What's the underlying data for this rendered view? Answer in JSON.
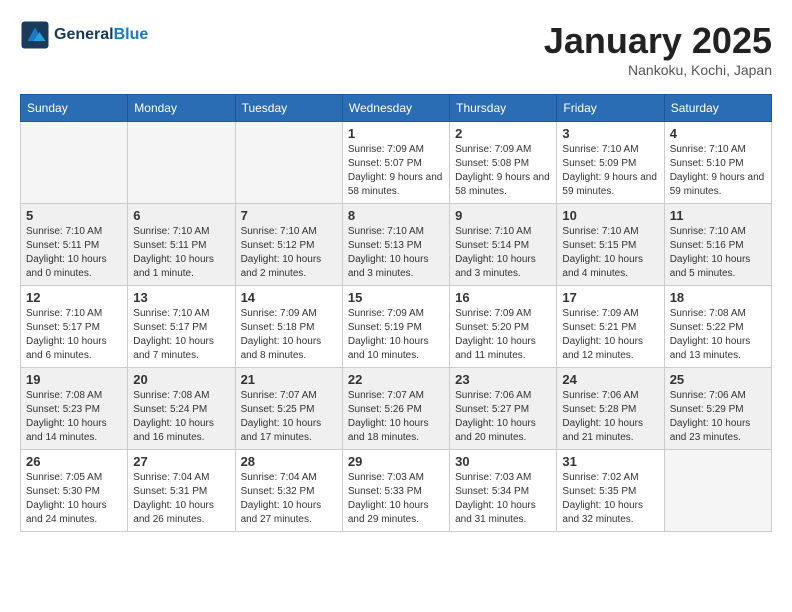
{
  "header": {
    "logo_line1": "General",
    "logo_line2": "Blue",
    "month_title": "January 2025",
    "location": "Nankoku, Kochi, Japan"
  },
  "days_of_week": [
    "Sunday",
    "Monday",
    "Tuesday",
    "Wednesday",
    "Thursday",
    "Friday",
    "Saturday"
  ],
  "weeks": [
    {
      "shaded": false,
      "days": [
        {
          "num": "",
          "sunrise": "",
          "sunset": "",
          "daylight": ""
        },
        {
          "num": "",
          "sunrise": "",
          "sunset": "",
          "daylight": ""
        },
        {
          "num": "",
          "sunrise": "",
          "sunset": "",
          "daylight": ""
        },
        {
          "num": "1",
          "sunrise": "Sunrise: 7:09 AM",
          "sunset": "Sunset: 5:07 PM",
          "daylight": "Daylight: 9 hours and 58 minutes."
        },
        {
          "num": "2",
          "sunrise": "Sunrise: 7:09 AM",
          "sunset": "Sunset: 5:08 PM",
          "daylight": "Daylight: 9 hours and 58 minutes."
        },
        {
          "num": "3",
          "sunrise": "Sunrise: 7:10 AM",
          "sunset": "Sunset: 5:09 PM",
          "daylight": "Daylight: 9 hours and 59 minutes."
        },
        {
          "num": "4",
          "sunrise": "Sunrise: 7:10 AM",
          "sunset": "Sunset: 5:10 PM",
          "daylight": "Daylight: 9 hours and 59 minutes."
        }
      ]
    },
    {
      "shaded": true,
      "days": [
        {
          "num": "5",
          "sunrise": "Sunrise: 7:10 AM",
          "sunset": "Sunset: 5:11 PM",
          "daylight": "Daylight: 10 hours and 0 minutes."
        },
        {
          "num": "6",
          "sunrise": "Sunrise: 7:10 AM",
          "sunset": "Sunset: 5:11 PM",
          "daylight": "Daylight: 10 hours and 1 minute."
        },
        {
          "num": "7",
          "sunrise": "Sunrise: 7:10 AM",
          "sunset": "Sunset: 5:12 PM",
          "daylight": "Daylight: 10 hours and 2 minutes."
        },
        {
          "num": "8",
          "sunrise": "Sunrise: 7:10 AM",
          "sunset": "Sunset: 5:13 PM",
          "daylight": "Daylight: 10 hours and 3 minutes."
        },
        {
          "num": "9",
          "sunrise": "Sunrise: 7:10 AM",
          "sunset": "Sunset: 5:14 PM",
          "daylight": "Daylight: 10 hours and 3 minutes."
        },
        {
          "num": "10",
          "sunrise": "Sunrise: 7:10 AM",
          "sunset": "Sunset: 5:15 PM",
          "daylight": "Daylight: 10 hours and 4 minutes."
        },
        {
          "num": "11",
          "sunrise": "Sunrise: 7:10 AM",
          "sunset": "Sunset: 5:16 PM",
          "daylight": "Daylight: 10 hours and 5 minutes."
        }
      ]
    },
    {
      "shaded": false,
      "days": [
        {
          "num": "12",
          "sunrise": "Sunrise: 7:10 AM",
          "sunset": "Sunset: 5:17 PM",
          "daylight": "Daylight: 10 hours and 6 minutes."
        },
        {
          "num": "13",
          "sunrise": "Sunrise: 7:10 AM",
          "sunset": "Sunset: 5:17 PM",
          "daylight": "Daylight: 10 hours and 7 minutes."
        },
        {
          "num": "14",
          "sunrise": "Sunrise: 7:09 AM",
          "sunset": "Sunset: 5:18 PM",
          "daylight": "Daylight: 10 hours and 8 minutes."
        },
        {
          "num": "15",
          "sunrise": "Sunrise: 7:09 AM",
          "sunset": "Sunset: 5:19 PM",
          "daylight": "Daylight: 10 hours and 10 minutes."
        },
        {
          "num": "16",
          "sunrise": "Sunrise: 7:09 AM",
          "sunset": "Sunset: 5:20 PM",
          "daylight": "Daylight: 10 hours and 11 minutes."
        },
        {
          "num": "17",
          "sunrise": "Sunrise: 7:09 AM",
          "sunset": "Sunset: 5:21 PM",
          "daylight": "Daylight: 10 hours and 12 minutes."
        },
        {
          "num": "18",
          "sunrise": "Sunrise: 7:08 AM",
          "sunset": "Sunset: 5:22 PM",
          "daylight": "Daylight: 10 hours and 13 minutes."
        }
      ]
    },
    {
      "shaded": true,
      "days": [
        {
          "num": "19",
          "sunrise": "Sunrise: 7:08 AM",
          "sunset": "Sunset: 5:23 PM",
          "daylight": "Daylight: 10 hours and 14 minutes."
        },
        {
          "num": "20",
          "sunrise": "Sunrise: 7:08 AM",
          "sunset": "Sunset: 5:24 PM",
          "daylight": "Daylight: 10 hours and 16 minutes."
        },
        {
          "num": "21",
          "sunrise": "Sunrise: 7:07 AM",
          "sunset": "Sunset: 5:25 PM",
          "daylight": "Daylight: 10 hours and 17 minutes."
        },
        {
          "num": "22",
          "sunrise": "Sunrise: 7:07 AM",
          "sunset": "Sunset: 5:26 PM",
          "daylight": "Daylight: 10 hours and 18 minutes."
        },
        {
          "num": "23",
          "sunrise": "Sunrise: 7:06 AM",
          "sunset": "Sunset: 5:27 PM",
          "daylight": "Daylight: 10 hours and 20 minutes."
        },
        {
          "num": "24",
          "sunrise": "Sunrise: 7:06 AM",
          "sunset": "Sunset: 5:28 PM",
          "daylight": "Daylight: 10 hours and 21 minutes."
        },
        {
          "num": "25",
          "sunrise": "Sunrise: 7:06 AM",
          "sunset": "Sunset: 5:29 PM",
          "daylight": "Daylight: 10 hours and 23 minutes."
        }
      ]
    },
    {
      "shaded": false,
      "days": [
        {
          "num": "26",
          "sunrise": "Sunrise: 7:05 AM",
          "sunset": "Sunset: 5:30 PM",
          "daylight": "Daylight: 10 hours and 24 minutes."
        },
        {
          "num": "27",
          "sunrise": "Sunrise: 7:04 AM",
          "sunset": "Sunset: 5:31 PM",
          "daylight": "Daylight: 10 hours and 26 minutes."
        },
        {
          "num": "28",
          "sunrise": "Sunrise: 7:04 AM",
          "sunset": "Sunset: 5:32 PM",
          "daylight": "Daylight: 10 hours and 27 minutes."
        },
        {
          "num": "29",
          "sunrise": "Sunrise: 7:03 AM",
          "sunset": "Sunset: 5:33 PM",
          "daylight": "Daylight: 10 hours and 29 minutes."
        },
        {
          "num": "30",
          "sunrise": "Sunrise: 7:03 AM",
          "sunset": "Sunset: 5:34 PM",
          "daylight": "Daylight: 10 hours and 31 minutes."
        },
        {
          "num": "31",
          "sunrise": "Sunrise: 7:02 AM",
          "sunset": "Sunset: 5:35 PM",
          "daylight": "Daylight: 10 hours and 32 minutes."
        },
        {
          "num": "",
          "sunrise": "",
          "sunset": "",
          "daylight": ""
        }
      ]
    }
  ]
}
